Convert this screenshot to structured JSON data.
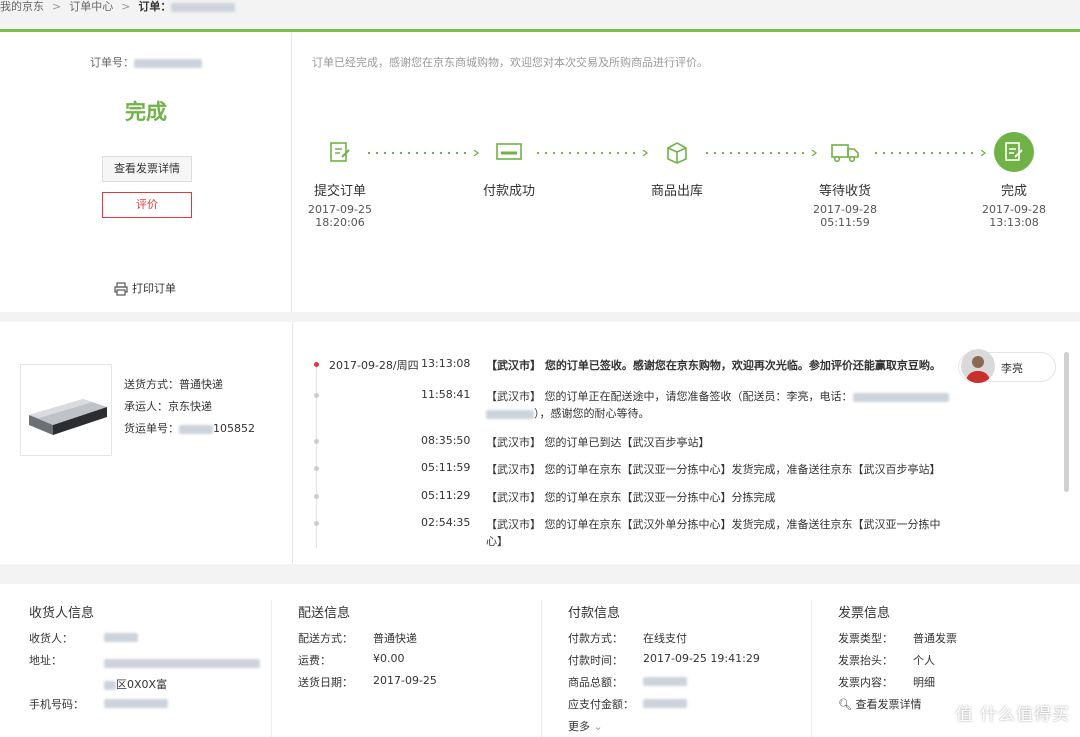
{
  "breadcrumb": {
    "home": "我的京东",
    "center": "订单中心",
    "current": "订单："
  },
  "order": {
    "number_label": "订单号：",
    "status": "完成",
    "invoice_button": "查看发票详情",
    "review_button": "评价",
    "print": "打印订单",
    "notice": "订单已经完成，感谢您在京东商城购物，欢迎您对本次交易及所购商品进行评价。"
  },
  "progress": {
    "steps": [
      {
        "name": "提交订单",
        "date": "2017-09-25",
        "time": "18:20:06"
      },
      {
        "name": "付款成功",
        "date": "",
        "time": ""
      },
      {
        "name": "商品出库",
        "date": "",
        "time": ""
      },
      {
        "name": "等待收货",
        "date": "2017-09-28",
        "time": "05:11:59"
      },
      {
        "name": "完成",
        "date": "2017-09-28",
        "time": "13:13:08"
      }
    ]
  },
  "shipment": {
    "method": "送货方式：普通快递",
    "carrier": "承运人：京东快递",
    "tracking_label": "货运单号：",
    "tracking_suffix": "105852"
  },
  "tracking": [
    {
      "date": "2017-09-28/周四",
      "time": "13:13:08",
      "text": "【武汉市】 您的订单已签收。感谢您在京东购物，欢迎再次光临。参加评价还能赢取京豆哟。"
    },
    {
      "date": "",
      "time": "11:58:41",
      "text": "【武汉市】 您的订单正在配送途中，请您准备签收（配送员：李亮，电话：",
      "text2": "），感谢您的耐心等待。"
    },
    {
      "date": "",
      "time": "08:35:50",
      "text": "【武汉市】 您的订单已到达【武汉百步亭站】"
    },
    {
      "date": "",
      "time": "05:11:59",
      "text": "【武汉市】 您的订单在京东【武汉亚一分拣中心】发货完成，准备送往京东【武汉百步亭站】"
    },
    {
      "date": "",
      "time": "05:11:29",
      "text": "【武汉市】 您的订单在京东【武汉亚一分拣中心】分拣完成"
    },
    {
      "date": "",
      "time": "02:54:35",
      "text": "【武汉市】 您的订单在京东【武汉外单分拣中心】发货完成，准备送往京东【武汉亚一分拣中心】"
    }
  ],
  "courier": {
    "name": "李亮"
  },
  "info": {
    "receiver": {
      "title": "收货人信息",
      "name_label": "收货人：",
      "address_label": "地址：",
      "address_suffix": "区0X0X富",
      "phone_label": "手机号码："
    },
    "delivery": {
      "title": "配送信息",
      "method_label": "配送方式：",
      "method": "普通快递",
      "fee_label": "运费：",
      "fee": "¥0.00",
      "date_label": "送货日期：",
      "date": "2017-09-25"
    },
    "payment": {
      "title": "付款信息",
      "method_label": "付款方式：",
      "method": "在线支付",
      "time_label": "付款时间：",
      "time": "2017-09-25 19:41:29",
      "total_label": "商品总额：",
      "due_label": "应支付金额：",
      "more": "更多"
    },
    "invoice": {
      "title": "发票信息",
      "type_label": "发票类型：",
      "type": "普通发票",
      "header_label": "发票抬头：",
      "header": "个人",
      "content_label": "发票内容：",
      "content": "明细",
      "view": "查看发票详情"
    }
  },
  "watermark": "值 什么值得买",
  "colors": {
    "accent": "#71b247",
    "danger": "#e4393c"
  }
}
